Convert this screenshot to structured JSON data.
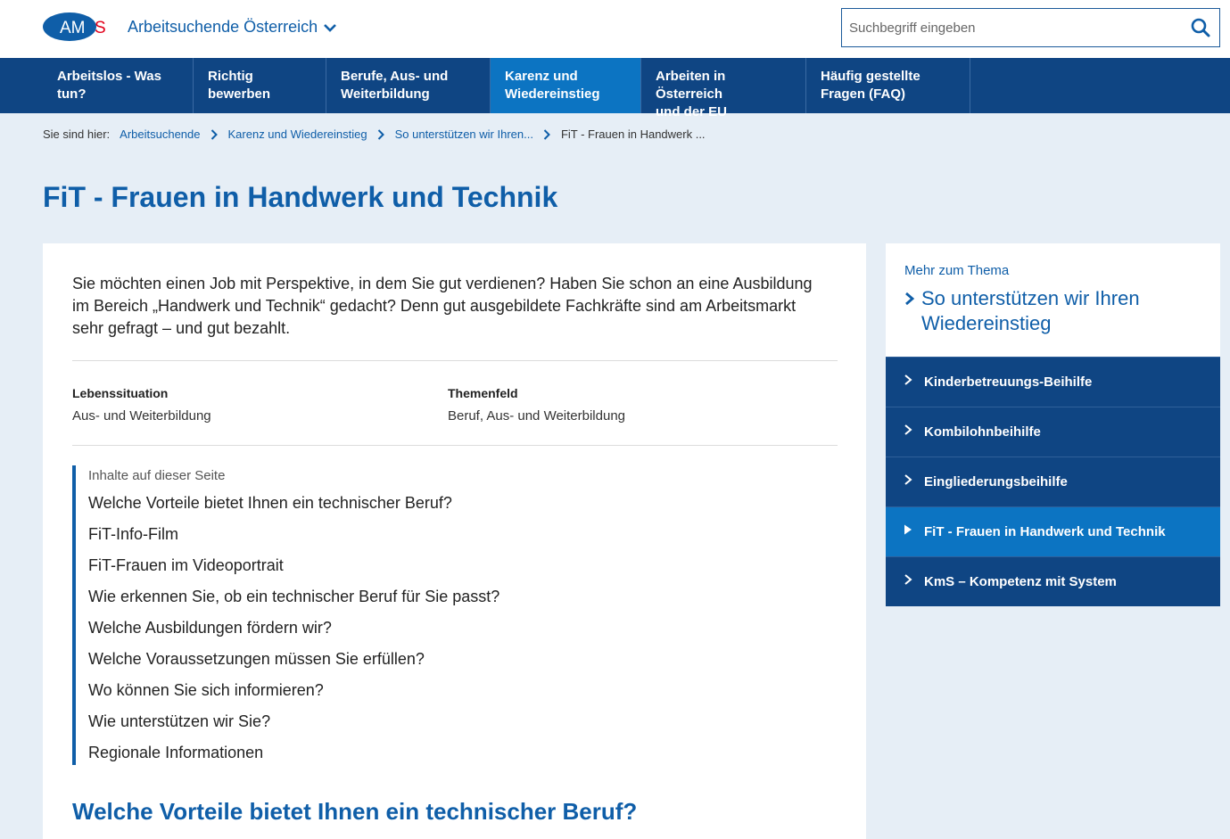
{
  "header": {
    "logo_text": "AMS",
    "site_switch_label": "Arbeitsuchende Österreich",
    "search_placeholder": "Suchbegriff eingeben"
  },
  "nav": {
    "items": [
      {
        "line1": "Arbeitslos - Was",
        "line2": "tun?"
      },
      {
        "line1": "Richtig",
        "line2": "bewerben"
      },
      {
        "line1": "Berufe, Aus- und",
        "line2": "Weiterbildung"
      },
      {
        "line1": "Karenz und",
        "line2": "Wiedereinstieg",
        "active": true
      },
      {
        "line1": "Arbeiten in Österreich",
        "line2": "und der EU"
      },
      {
        "line1": "Häufig gestellte",
        "line2": "Fragen (FAQ)"
      }
    ]
  },
  "breadcrumb": {
    "label": "Sie sind hier:",
    "items": [
      "Arbeitsuchende",
      "Karenz und Wiedereinstieg",
      "So unterstützen wir Ihren..."
    ],
    "current": "FiT - Frauen in Handwerk ..."
  },
  "page_title": "FiT - Frauen in Handwerk und Technik",
  "intro_text": "Sie möchten einen Job mit Perspektive, in dem Sie gut verdienen? Haben Sie schon an eine Ausbildung im Bereich „Handwerk und Technik“ gedacht? Denn gut ausgebildete Fachkräfte sind am Arbeitsmarkt sehr gefragt – und gut bezahlt.",
  "meta": {
    "situation_label": "Lebenssituation",
    "situation_value": "Aus- und Weiterbildung",
    "topic_label": "Themenfeld",
    "topic_value": "Beruf, Aus- und Weiterbildung"
  },
  "toc": {
    "title": "Inhalte auf dieser Seite",
    "items": [
      "Welche Vorteile bietet Ihnen ein technischer Beruf?",
      "FiT-Info-Film",
      "FiT-Frauen im Videoportrait",
      "Wie erkennen Sie, ob ein technischer Beruf für Sie passt?",
      "Welche Ausbildungen fördern wir?",
      "Welche Voraussetzungen müssen Sie erfüllen?",
      "Wo können Sie sich informieren?",
      "Wie unterstützen wir Sie?",
      "Regionale Informationen"
    ]
  },
  "section_heading": "Welche Vorteile bietet Ihnen ein technischer Beruf?",
  "sidebar": {
    "more_label": "Mehr zum Thema",
    "main_link_line1": "So unterstützen wir Ihren",
    "main_link_line2": "Wiedereinstieg",
    "items": [
      "Kinderbetreuungs-Beihilfe",
      "Kombilohnbeihilfe",
      "Eingliederungsbeihilfe",
      "FiT - Frauen in Handwerk und Technik",
      "KmS – Kompetenz mit System"
    ],
    "active_index": 3
  },
  "colors": {
    "brand_blue": "#0f5ea8",
    "nav_dark": "#0f4583",
    "nav_active": "#0c74c2",
    "logo_red": "#e2001a",
    "background": "#e6eef6"
  }
}
